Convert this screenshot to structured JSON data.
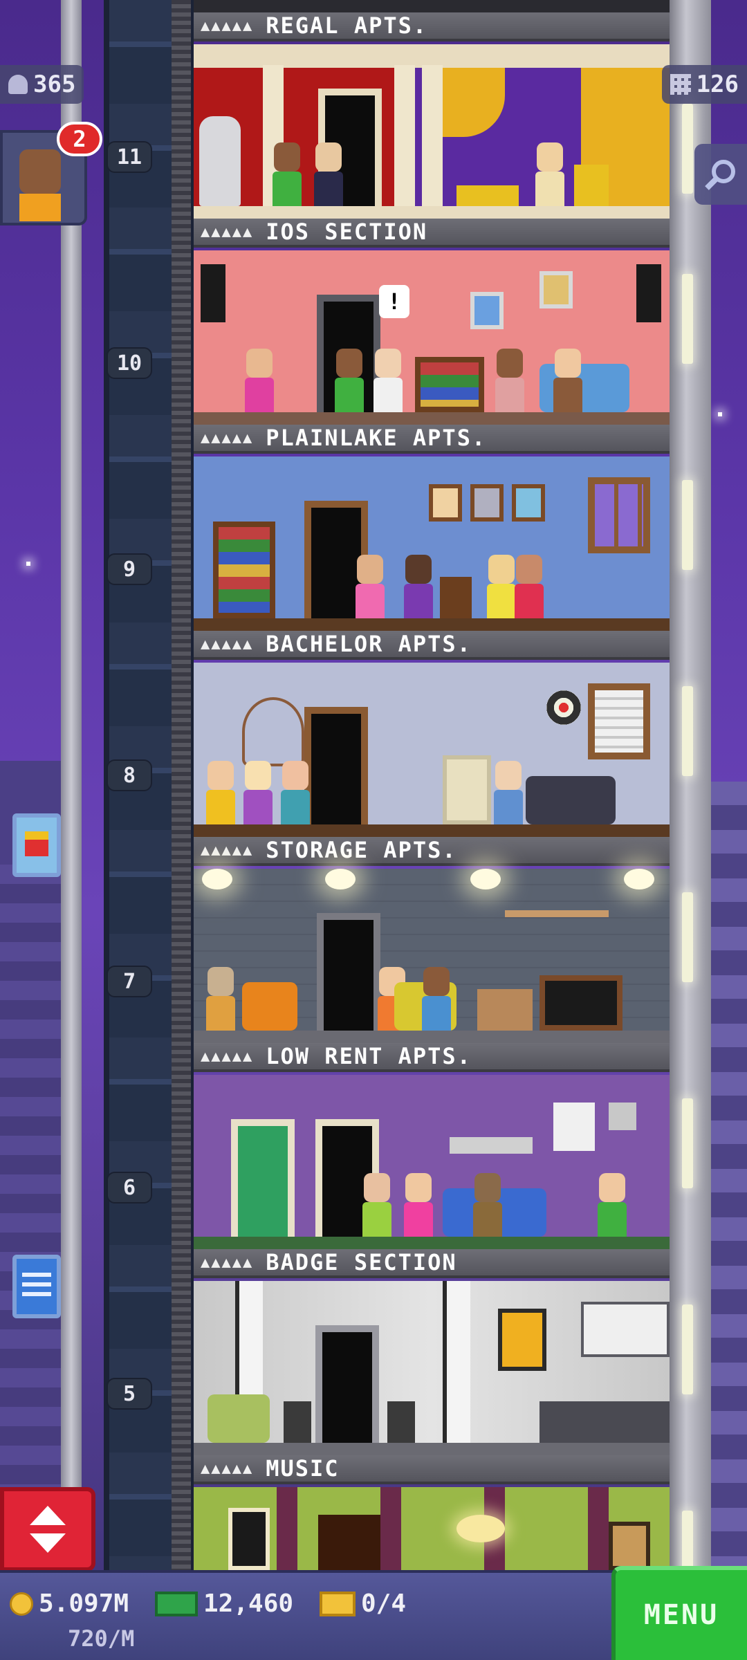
{
  "hud": {
    "population": "365",
    "floors_count": "126",
    "visitor_notifications": "2"
  },
  "floors": [
    {
      "number": "11",
      "name": "REGAL APTS.",
      "stars": "▲▲▲▲▲"
    },
    {
      "number": "10",
      "name": "IOS SECTION",
      "stars": "▲▲▲▲▲"
    },
    {
      "number": "9",
      "name": "PLAINLAKE APTS.",
      "stars": "▲▲▲▲▲"
    },
    {
      "number": "8",
      "name": "BACHELOR APTS.",
      "stars": "▲▲▲▲▲"
    },
    {
      "number": "7",
      "name": "STORAGE APTS.",
      "stars": "▲▲▲▲▲"
    },
    {
      "number": "6",
      "name": "LOW RENT APTS.",
      "stars": "▲▲▲▲▲"
    },
    {
      "number": "5",
      "name": "BADGE SECTION",
      "stars": "▲▲▲▲▲"
    },
    {
      "number": "",
      "name": "MUSIC",
      "stars": "▲▲▲▲▲"
    }
  ],
  "bottom_bar": {
    "coins": "5.097M",
    "coins_rate": "720/M",
    "bux": "12,460",
    "tickets": "0/4",
    "menu_label": "MENU"
  },
  "icons": {
    "population": "person-icon",
    "floors": "building-grid-icon",
    "search": "magnifier-icon",
    "elevator": "up-down-arrows-icon",
    "coins": "coin-icon",
    "bux": "tower-bux-icon",
    "tickets": "golden-ticket-icon"
  },
  "colors": {
    "sky_top": "#4a2a8c",
    "menu_green": "#2bbf3a",
    "elevator_red": "#e02436",
    "badge_red": "#e02a2a"
  }
}
